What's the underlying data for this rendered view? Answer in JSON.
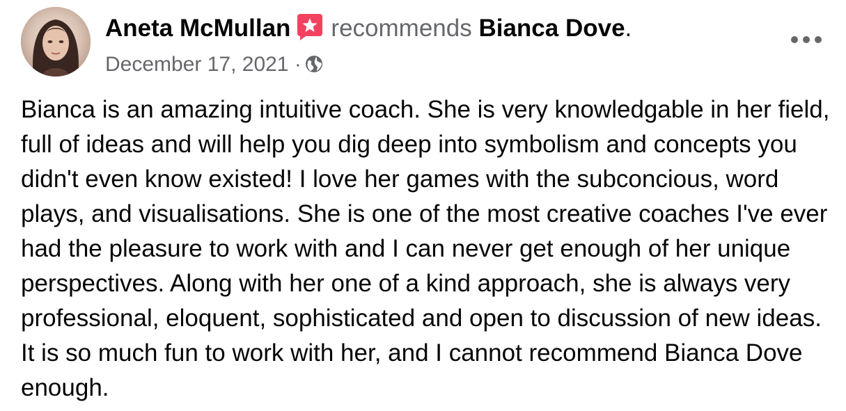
{
  "post": {
    "author": "Aneta McMullan",
    "author_badge_icon": "star-recommendation-icon",
    "verb": "recommends",
    "recommended": "Bianca Dove",
    "period": ".",
    "date": "December 17, 2021",
    "separator": "·",
    "privacy_icon": "globe-icon",
    "more_icon": "more-options-icon",
    "body": "Bianca is an amazing intuitive coach. She is very knowledgable in her field, full of ideas and will help you dig deep into symbolism and concepts you didn't even know existed! I love her games with the subconcious, word plays, and visualisations. She is one of the most creative coaches I've ever had the pleasure to work with and I can never get enough of her unique perspectives. Along with her one of a kind approach, she is always very professional, eloquent, sophisticated and open to discussion of new ideas. It is so much fun to work with her, and I cannot recommend Bianca Dove enough."
  },
  "colors": {
    "badge": "#f3425f",
    "secondary_text": "#65676b",
    "primary_text": "#050505"
  }
}
